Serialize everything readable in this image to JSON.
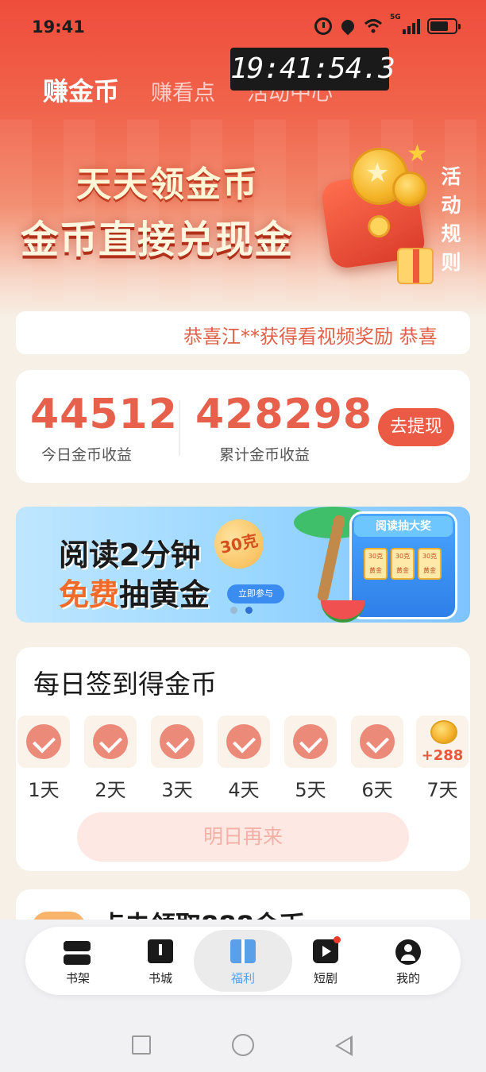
{
  "status_bar": {
    "time": "19:41",
    "network": "5G",
    "icons": [
      "alarm-icon",
      "location-icon",
      "wifi-icon",
      "signal-icon",
      "battery-icon"
    ]
  },
  "clock_overlay": "19:41:54.3",
  "tabs": [
    {
      "label": "赚金币",
      "active": true
    },
    {
      "label": "赚看点",
      "active": false
    },
    {
      "label": "活动中心",
      "active": false
    }
  ],
  "hero_banner": {
    "line1": "天天领金币",
    "line2": "金币直接兑现金",
    "rules_link": "活动规则"
  },
  "marquee": {
    "text": "恭喜江**获得看视频奖励  恭喜"
  },
  "earnings": {
    "today_value": "44512",
    "today_label": "今日金币收益",
    "total_value": "428298",
    "total_label": "累计金币收益",
    "withdraw_button": "去提现"
  },
  "promo": {
    "line1": "阅读2分钟",
    "line2_highlight": "免费",
    "line2_rest": "抽黄金",
    "badge": "30克",
    "cta": "立即参与",
    "machine_title": "阅读抽大奖",
    "reel_text": "30克黄金",
    "active_slide": 2,
    "slide_count": 2
  },
  "sign_in": {
    "title": "每日签到得金币",
    "days": [
      {
        "label": "1天",
        "checked": true
      },
      {
        "label": "2天",
        "checked": true
      },
      {
        "label": "3天",
        "checked": true
      },
      {
        "label": "4天",
        "checked": true
      },
      {
        "label": "5天",
        "checked": true
      },
      {
        "label": "6天",
        "checked": true
      },
      {
        "label": "7天",
        "checked": false,
        "reward": "+288"
      }
    ],
    "button": "明日再来"
  },
  "next_card": {
    "title": "点击领取888金币"
  },
  "bottom_nav": [
    {
      "label": "书架",
      "icon": "bookshelf-icon",
      "active": false
    },
    {
      "label": "书城",
      "icon": "bookstore-icon",
      "active": false
    },
    {
      "label": "福利",
      "icon": "gift-icon",
      "active": true
    },
    {
      "label": "短剧",
      "icon": "play-icon",
      "active": false,
      "badge_dot": true
    },
    {
      "label": "我的",
      "icon": "profile-icon",
      "active": false
    }
  ],
  "colors": {
    "brand_red": "#ea5a44",
    "coin_number": "#e6604c",
    "active_nav": "#5aa0e8"
  }
}
